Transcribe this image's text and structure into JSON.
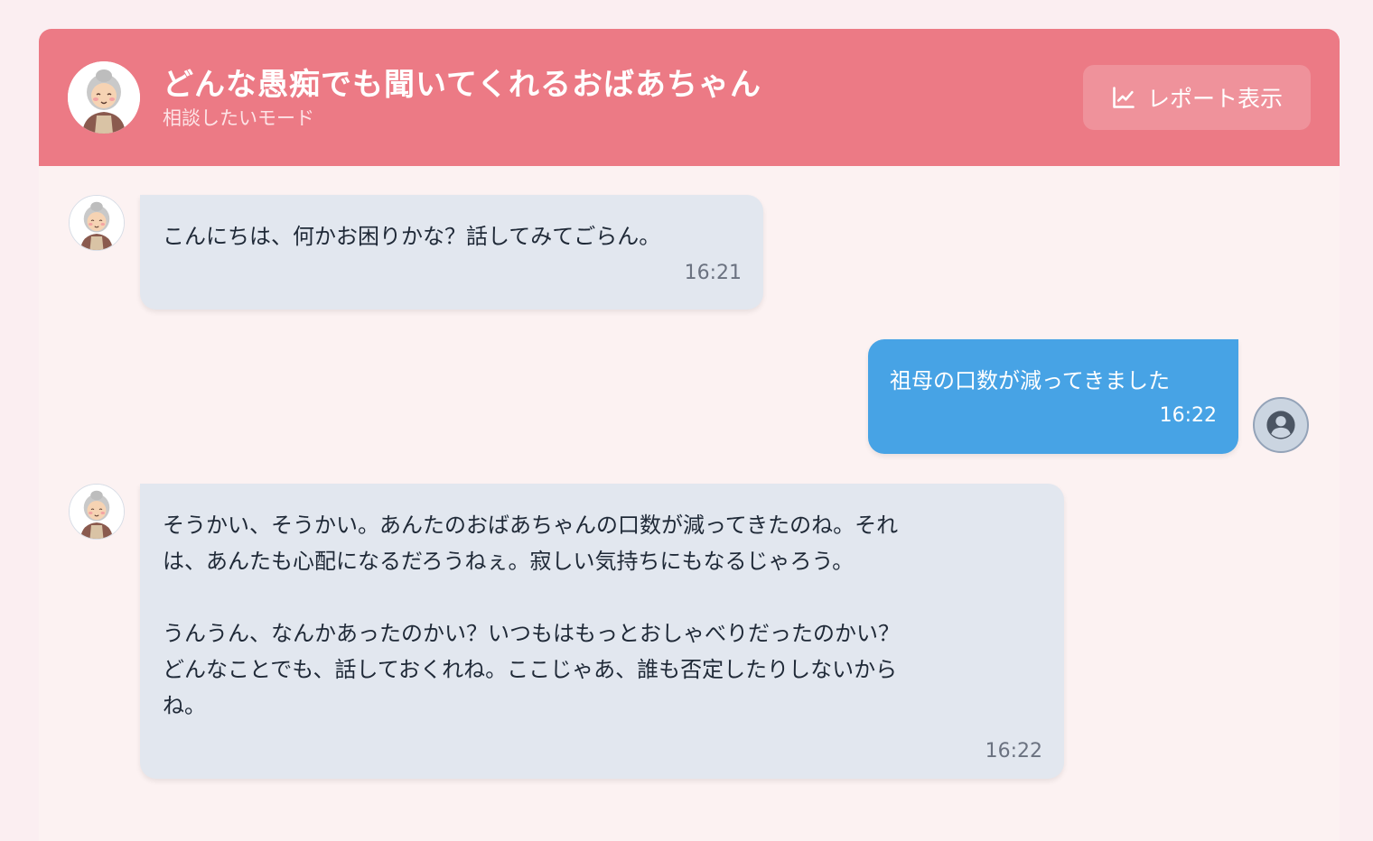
{
  "header": {
    "title": "どんな愚痴でも聞いてくれるおばあちゃん",
    "subtitle": "相談したいモード",
    "report_button_label": "レポート表示",
    "report_icon": "chart-line-icon",
    "avatar_icon": "grandmother-avatar-icon"
  },
  "messages": [
    {
      "sender": "grandmother",
      "text": "こんにちは、何かお困りかな？話してみてごらん。",
      "time": "16:21"
    },
    {
      "sender": "user",
      "text": "祖母の口数が減ってきました",
      "time": "16:22"
    },
    {
      "sender": "grandmother",
      "text": "そうかい、そうかい。あんたのおばあちゃんの口数が減ってきたのね。それ\nは、あんたも心配になるだろうねぇ。寂しい気持ちにもなるじゃろう。\n\nうんうん、なんかあったのかい？いつもはもっとおしゃべりだったのかい？\nどんなことでも、話しておくれね。ここじゃあ、誰も否定したりしないから\nね。",
      "time": "16:22"
    }
  ],
  "colors": {
    "header_bg": "#ec7a85",
    "bot_bubble": "#e2e7ef",
    "user_bubble": "#47a3e5",
    "page_bg": "#fbeef1"
  }
}
